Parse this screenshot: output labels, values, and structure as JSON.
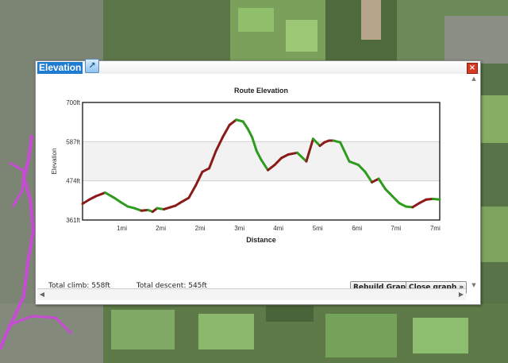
{
  "window": {
    "title": "Elevation",
    "popout_icon": "popout-icon",
    "close_label": "×",
    "close_icon": "close-icon"
  },
  "chart_data": {
    "type": "line",
    "title": "Route Elevation",
    "xlabel": "Distance",
    "ylabel": "Elevation",
    "yticks": [
      "700ft",
      "587ft",
      "474ft",
      "361ft"
    ],
    "ytick_values": [
      700,
      587,
      474,
      361
    ],
    "ylim": [
      361,
      700
    ],
    "xlim": [
      0,
      7.9
    ],
    "xtick_labels": [
      "1mi",
      "2mi",
      "2mi",
      "3mi",
      "4mi",
      "5mi",
      "6mi",
      "7mi",
      "7mi"
    ],
    "xtick_values": [
      0.87,
      1.73,
      2.6,
      3.47,
      4.33,
      5.2,
      6.07,
      6.93,
      7.8
    ],
    "grid": "horizontal bands",
    "colors": {
      "climb": "#8b1a1a",
      "descent": "#2e9b1f",
      "band": "#f2f2f2"
    },
    "series": [
      {
        "x": [
          0,
          0.15,
          0.3,
          0.5,
          0.7,
          0.85,
          1.0,
          1.15,
          1.3,
          1.45,
          1.55,
          1.65,
          1.8,
          1.95,
          2.05,
          2.15,
          2.35,
          2.5,
          2.65,
          2.8,
          2.95,
          3.1,
          3.25,
          3.4,
          3.55,
          3.65,
          3.75,
          3.85,
          3.95,
          4.1,
          4.25,
          4.4,
          4.55,
          4.75,
          4.95,
          5.1,
          5.25,
          5.35,
          5.45,
          5.55,
          5.7,
          5.9,
          6.1,
          6.25,
          6.4,
          6.55,
          6.7,
          6.85,
          7.0,
          7.15,
          7.3,
          7.45,
          7.6,
          7.75,
          7.9
        ],
        "y": [
          408,
          420,
          430,
          440,
          425,
          412,
          400,
          395,
          388,
          390,
          385,
          395,
          392,
          398,
          402,
          410,
          425,
          460,
          500,
          510,
          560,
          600,
          635,
          650,
          645,
          625,
          600,
          560,
          535,
          505,
          520,
          540,
          550,
          555,
          530,
          595,
          575,
          585,
          590,
          590,
          585,
          530,
          520,
          500,
          470,
          480,
          450,
          430,
          410,
          400,
          398,
          410,
          420,
          422,
          420
        ]
      }
    ]
  },
  "summary": {
    "total_climb": "Total climb: 558ft",
    "total_descent": "Total descent: 545ft"
  },
  "buttons": {
    "rebuild": "Rebuild Graph",
    "close_graph": "Close graph »"
  }
}
